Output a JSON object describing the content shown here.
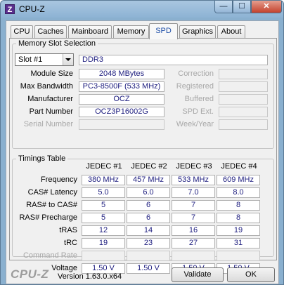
{
  "window": {
    "title": "CPU-Z",
    "icon_letter": "Z"
  },
  "titlebar_buttons": {
    "minimize": "—",
    "maximize": "☐",
    "close": "✕"
  },
  "tabs": [
    "CPU",
    "Caches",
    "Mainboard",
    "Memory",
    "SPD",
    "Graphics",
    "About"
  ],
  "memory_slot": {
    "group_title": "Memory Slot Selection",
    "slot_selected": "Slot #1",
    "type": "DDR3",
    "module_size_label": "Module Size",
    "module_size": "2048 MBytes",
    "max_bandwidth_label": "Max Bandwidth",
    "max_bandwidth": "PC3-8500F (533 MHz)",
    "manufacturer_label": "Manufacturer",
    "manufacturer": "OCZ",
    "part_number_label": "Part Number",
    "part_number": "OCZ3P16002G",
    "serial_number_label": "Serial Number",
    "correction_label": "Correction",
    "registered_label": "Registered",
    "buffered_label": "Buffered",
    "spd_ext_label": "SPD Ext.",
    "week_year_label": "Week/Year"
  },
  "timings": {
    "group_title": "Timings Table",
    "columns": [
      "JEDEC #1",
      "JEDEC #2",
      "JEDEC #3",
      "JEDEC #4"
    ],
    "rows": [
      {
        "label": "Frequency",
        "values": [
          "380 MHz",
          "457 MHz",
          "533 MHz",
          "609 MHz"
        ]
      },
      {
        "label": "CAS# Latency",
        "values": [
          "5.0",
          "6.0",
          "7.0",
          "8.0"
        ]
      },
      {
        "label": "RAS# to CAS#",
        "values": [
          "5",
          "6",
          "7",
          "8"
        ]
      },
      {
        "label": "RAS# Precharge",
        "values": [
          "5",
          "6",
          "7",
          "8"
        ]
      },
      {
        "label": "tRAS",
        "values": [
          "12",
          "14",
          "16",
          "19"
        ]
      },
      {
        "label": "tRC",
        "values": [
          "19",
          "23",
          "27",
          "31"
        ]
      },
      {
        "label": "Command Rate",
        "values": [
          "",
          "",
          "",
          ""
        ]
      },
      {
        "label": "Voltage",
        "values": [
          "1.50 V",
          "1.50 V",
          "1.50 V",
          "1.50 V"
        ]
      }
    ]
  },
  "footer": {
    "brand": "CPU-Z",
    "version": "Version 1.63.0.x64",
    "validate_label": "Validate",
    "ok_label": "OK"
  },
  "colors": {
    "value_text": "#202080",
    "active_tab_text": "#1f4fa8",
    "frame": "#8ab0cf"
  }
}
